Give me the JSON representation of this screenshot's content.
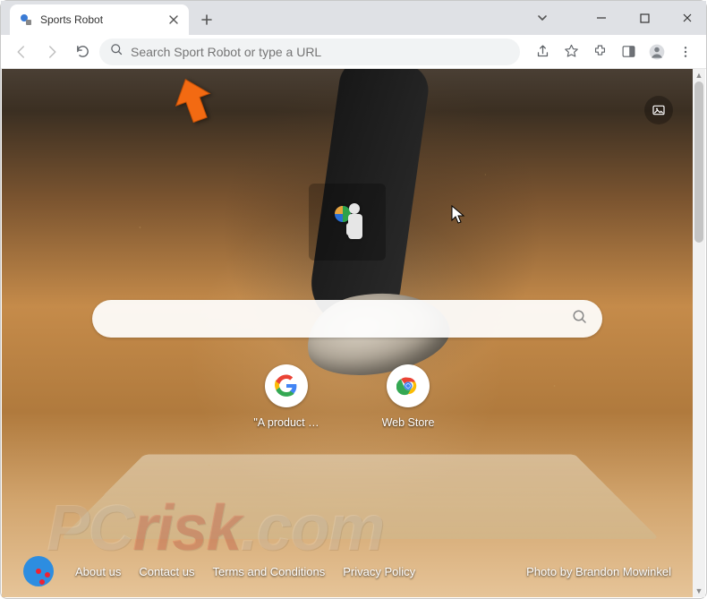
{
  "window": {
    "tab_title": "Sports Robot"
  },
  "toolbar": {
    "omnibox_placeholder": "Search Sport Robot or type a URL"
  },
  "page": {
    "search_placeholder": "",
    "shortcuts": [
      {
        "label": "\"A product …",
        "icon": "google"
      },
      {
        "label": "Web Store",
        "icon": "chrome"
      }
    ],
    "footer_links": [
      "About us",
      "Contact us",
      "Terms and Conditions",
      "Privacy Policy"
    ],
    "attribution": "Photo by Brandon Mowinkel"
  },
  "watermark": "PCrisk.com",
  "colors": {
    "accent_arrow": "#f36a12"
  }
}
